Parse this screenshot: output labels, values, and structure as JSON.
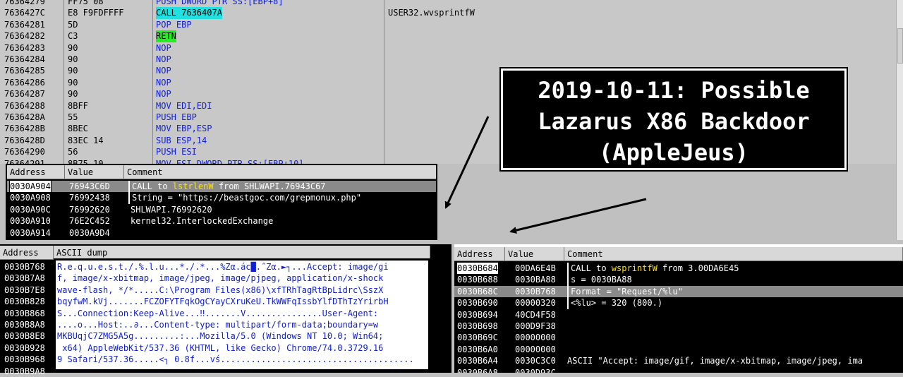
{
  "disasm": {
    "rows": [
      {
        "addr": "76364279",
        "hex": "FF75 08",
        "asm": "PUSH DWORD PTR SS:[EBP+8]",
        "style": "blue",
        "cmt": ""
      },
      {
        "addr": "7636427C",
        "hex": "E8 F9FDFFFF",
        "asm": "CALL 7636407A",
        "style": "cyan",
        "cmt": "USER32.wvsprintfW"
      },
      {
        "addr": "76364281",
        "hex": "5D",
        "asm": "POP EBP",
        "style": "blue",
        "cmt": ""
      },
      {
        "addr": "76364282",
        "hex": "C3",
        "asm": "RETN",
        "style": "green",
        "cmt": ""
      },
      {
        "addr": "76364283",
        "hex": "90",
        "asm": "NOP",
        "style": "blue",
        "cmt": ""
      },
      {
        "addr": "76364284",
        "hex": "90",
        "asm": "NOP",
        "style": "blue",
        "cmt": ""
      },
      {
        "addr": "76364285",
        "hex": "90",
        "asm": "NOP",
        "style": "blue",
        "cmt": ""
      },
      {
        "addr": "76364286",
        "hex": "90",
        "asm": "NOP",
        "style": "blue",
        "cmt": ""
      },
      {
        "addr": "76364287",
        "hex": "90",
        "asm": "NOP",
        "style": "blue",
        "cmt": ""
      },
      {
        "addr": "76364288",
        "hex": "8BFF",
        "asm": "MOV EDI,EDI",
        "style": "blue",
        "cmt": ""
      },
      {
        "addr": "7636428A",
        "hex": "55",
        "asm": "PUSH EBP",
        "style": "blue",
        "cmt": ""
      },
      {
        "addr": "7636428B",
        "hex": "8BEC",
        "asm": "MOV EBP,ESP",
        "style": "blue",
        "cmt": ""
      },
      {
        "addr": "7636428D",
        "hex": "83EC 14",
        "asm": "SUB ESP,14",
        "style": "blue",
        "cmt": ""
      },
      {
        "addr": "76364290",
        "hex": "56",
        "asm": "PUSH ESI",
        "style": "blue",
        "cmt": ""
      },
      {
        "addr": "76364291",
        "hex": "8B75 10",
        "asm": "MOV ESI,DWORD PTR SS:[EBP+10]",
        "style": "blue",
        "cmt": ""
      }
    ]
  },
  "stack_top": {
    "headers": [
      "Address",
      "Value",
      "Comment"
    ],
    "rows": [
      {
        "addr": "0030A904",
        "val": "76943C6D",
        "cmt_pre": "CALL to ",
        "cmt_hl": "lstrlenW",
        "cmt_post": " from SHLWAPI.76943C67",
        "bracket": "top",
        "selected": true
      },
      {
        "addr": "0030A908",
        "val": "76992438",
        "cmt_pre": "String = \"https://beastgoc.com/grepmonux.php\"",
        "cmt_hl": "",
        "cmt_post": "",
        "bracket": "bottom",
        "selected": false
      },
      {
        "addr": "0030A90C",
        "val": "76992620",
        "cmt_pre": "SHLWAPI.76992620",
        "cmt_hl": "",
        "cmt_post": "",
        "bracket": "",
        "selected": false
      },
      {
        "addr": "0030A910",
        "val": "76E2C452",
        "cmt_pre": "kernel32.InterlockedExchange",
        "cmt_hl": "",
        "cmt_post": "",
        "bracket": "",
        "selected": false
      },
      {
        "addr": "0030A914",
        "val": "0030A9D4",
        "cmt_pre": "",
        "cmt_hl": "",
        "cmt_post": "",
        "bracket": "",
        "selected": false
      }
    ]
  },
  "dump": {
    "headers": [
      "Address",
      "ASCII dump"
    ],
    "rows": [
      {
        "addr": "0030B768",
        "text": "R.e.q.u.e.s.t./.%.l.u...*./.*...%Zα.ác█.˝Zα.►┐...Accept: image/gi"
      },
      {
        "addr": "0030B7A8",
        "text": "f, image/x-xbitmap, image/jpeg, image/pjpeg, application/x-shock"
      },
      {
        "addr": "0030B7E8",
        "text": "wave-flash, */*.....C:\\Program Files(x86)\\xfTRhTagRtBpLidrc\\SszX"
      },
      {
        "addr": "0030B828",
        "text": "bqyfwM.kVj.......FCZOFYTFqkOgCYayCXruKeU.TkWWFqIssbYlfDThTzYrirbH"
      },
      {
        "addr": "0030B868",
        "text": "S...Connection:Keep-Alive...‼.......V...............User-Agent:"
      },
      {
        "addr": "0030B8A8",
        "text": "....o...Host:..∂...Content-type: multipart/form-data;boundary=w"
      },
      {
        "addr": "0030B8E8",
        "text": "MKBUqjC7ZMG5A5g.........:...Mozilla/5.0 (Windows NT 10.0; Win64;"
      },
      {
        "addr": "0030B928",
        "text": " x64) AppleWebKit/537.36 (KHTML, like Gecko) Chrome/74.0.3729.16"
      },
      {
        "addr": "0030B968",
        "text": "9 Safari/537.36.....<┐ 0.8f...vś......................................"
      },
      {
        "addr": "0030B9A8",
        "text": ""
      }
    ]
  },
  "stack_bottom": {
    "headers": [
      "Address",
      "Value",
      "Comment"
    ],
    "rows": [
      {
        "addr": "0030B684",
        "val": "00DA6E4B",
        "cmt_pre": "CALL to ",
        "cmt_hl": "wsprintfW",
        "cmt_post": " from 3.00DA6E45",
        "bracket": "top",
        "state": "selected"
      },
      {
        "addr": "0030B688",
        "val": "0030BA88",
        "cmt_pre": "s = 0030BA88",
        "cmt_hl": "",
        "cmt_post": "",
        "bracket": "mid",
        "state": ""
      },
      {
        "addr": "0030B68C",
        "val": "0030B768",
        "cmt_pre": "Format = \"Request/%lu\"",
        "cmt_hl": "",
        "cmt_post": "",
        "bracket": "mid",
        "state": "gray"
      },
      {
        "addr": "0030B690",
        "val": "00000320",
        "cmt_pre": "<%lu> = 320 (800.)",
        "cmt_hl": "",
        "cmt_post": "",
        "bracket": "bottom",
        "state": ""
      },
      {
        "addr": "0030B694",
        "val": "40CD4F58",
        "cmt_pre": "",
        "cmt_hl": "",
        "cmt_post": "",
        "bracket": "",
        "state": ""
      },
      {
        "addr": "0030B698",
        "val": "000D9F38",
        "cmt_pre": "",
        "cmt_hl": "",
        "cmt_post": "",
        "bracket": "",
        "state": ""
      },
      {
        "addr": "0030B69C",
        "val": "00000000",
        "cmt_pre": "",
        "cmt_hl": "",
        "cmt_post": "",
        "bracket": "",
        "state": ""
      },
      {
        "addr": "0030B6A0",
        "val": "00000000",
        "cmt_pre": "",
        "cmt_hl": "",
        "cmt_post": "",
        "bracket": "",
        "state": ""
      },
      {
        "addr": "0030B6A4",
        "val": "0030C3C0",
        "cmt_pre": "ASCII \"Accept: image/gif, image/x-xbitmap, image/jpeg, ima",
        "cmt_hl": "",
        "cmt_post": "",
        "bracket": "",
        "state": ""
      },
      {
        "addr": "0030B6A8",
        "val": "0030D93C",
        "cmt_pre": "",
        "cmt_hl": "",
        "cmt_post": "",
        "bracket": "",
        "state": ""
      }
    ]
  },
  "callout": {
    "lines": [
      "2019-10-11: Possible",
      "Lazarus X86 Backdoor",
      "(AppleJeus)"
    ]
  },
  "colors": {
    "asm_blue": "#1020e0",
    "call_cyan": "#22e0e0",
    "retn_green": "#22ee22",
    "api_yellow": "#ffe000",
    "dump_blue": "#1020d0"
  }
}
